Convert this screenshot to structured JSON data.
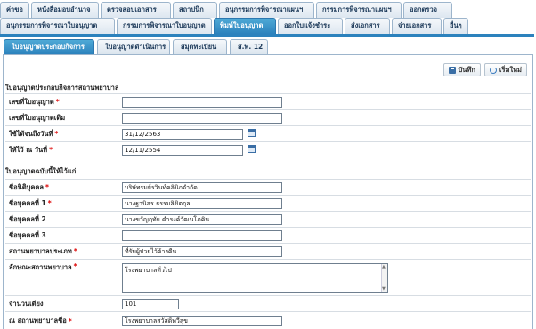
{
  "top_tabs_row1": [
    "ค่าขอ",
    "หนังสือมอบอำนาจ",
    "ตรวจสอบเอกสาร",
    "สถาปนิก",
    "อนุกรรมการพิจารณาแผนฯ",
    "กรรมการพิจารณาแผนฯ",
    "ออกตรวจ"
  ],
  "top_tabs_row2": [
    "อนุกรรมการพิจารณาใบอนุญาต",
    "กรรมการพิจารณาใบอนุญาต",
    "พิมพ์ใบอนุญาต",
    "ออกใบแจ้งชำระ",
    "ส่งเอกสาร",
    "จ่ายเอกสาร",
    "อื่นๆ"
  ],
  "sub_tabs": [
    "ใบอนุญาตประกอบกิจการ",
    "ใบอนุญาตดำเนินการ",
    "สมุดทะเบียน",
    "ส.พ. 12"
  ],
  "toolbar": {
    "save_label": "บันทึก",
    "reset_label": "เริ่มใหม่"
  },
  "section1_title": "ใบอนุญาตประกอบกิจการสถานพยาบาล",
  "section2_title": "ใบอนุญาตฉบับนี้ให้ไว้แก่",
  "fields": {
    "license_no": {
      "label": "เลขที่ใบอนุญาต",
      "value": ""
    },
    "old_license_no": {
      "label": "เลขที่ใบอนุญาตเดิม",
      "value": ""
    },
    "valid_until": {
      "label": "ใช้ได้จนถึงวันที่",
      "value": "31/12/2563"
    },
    "issued_on": {
      "label": "ให้ไว้ ณ วันที่",
      "value": "12/11/2554"
    },
    "juristic_name": {
      "label": "ชื่อนิติบุคคล",
      "value": "บริษัทรมย์รวินท์คลินิกจำกัด"
    },
    "person1": {
      "label": "ชื่อบุคคลที่ 1",
      "value": "นางฐานิสร ธรรมลิขิตกุล"
    },
    "person2": {
      "label": "ชื่อบุคคลที่ 2",
      "value": "นางขวัญฤทัย ดำรงค์วัฒนโภคิน"
    },
    "person3": {
      "label": "ชื่อบุคคลที่ 3",
      "value": ""
    },
    "facility_type": {
      "label": "สถานพยาบาลประเภท",
      "value": "ที่รับผู้ป่วยไว้ค้างคืน"
    },
    "facility_nature": {
      "label": "ลักษณะสถานพยาบาล",
      "value": "โรงพยาบาลทั่วไป"
    },
    "beds": {
      "label": "จำนวนเตียง",
      "value": "101"
    },
    "facility_name": {
      "label": "ณ สถานพยาบาลชื่อ",
      "value": "โรงพยาบาลสวัสดิ์ทวีสุข"
    }
  }
}
